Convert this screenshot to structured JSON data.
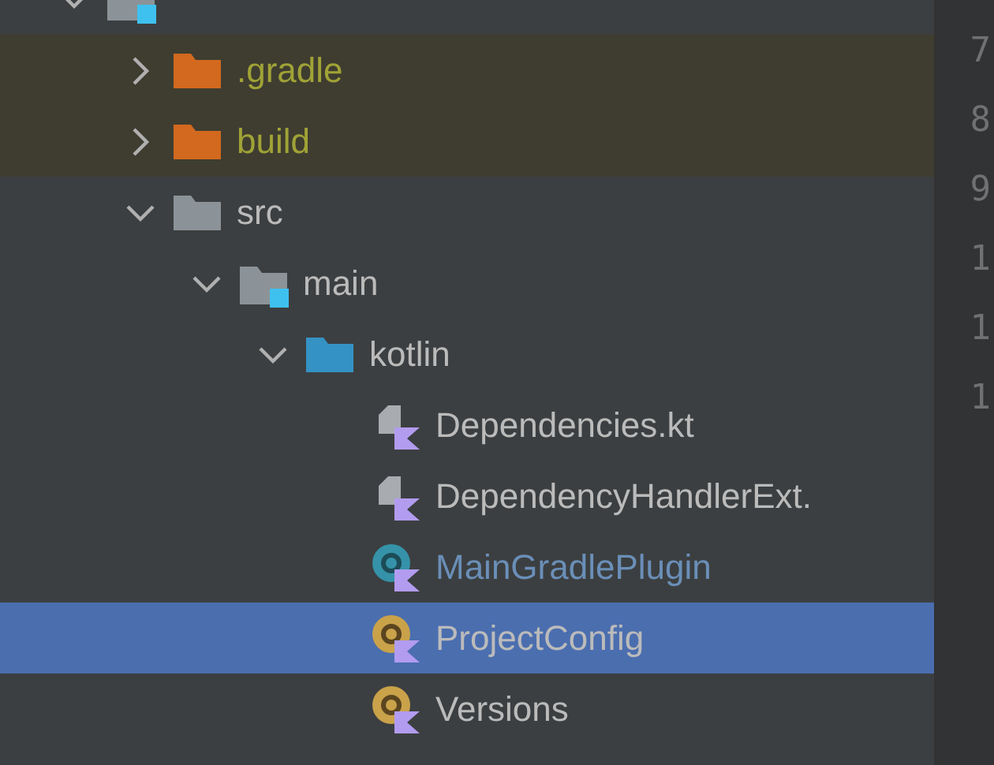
{
  "tree": [
    {
      "kind": "module",
      "expanded": true,
      "selected": false,
      "children": [
        {
          "label": ".gradle",
          "kind": "folder",
          "excluded": true,
          "modified": false,
          "expanded": false,
          "selected": false
        },
        {
          "label": "build",
          "kind": "folder",
          "excluded": true,
          "modified": false,
          "expanded": false,
          "selected": false
        },
        {
          "label": "src",
          "kind": "folder",
          "excluded": false,
          "modified": false,
          "expanded": true,
          "selected": false,
          "children": [
            {
              "label": "main",
              "kind": "module",
              "excluded": false,
              "modified": false,
              "expanded": true,
              "selected": false,
              "children": [
                {
                  "label": "kotlin",
                  "kind": "source-folder",
                  "excluded": false,
                  "modified": false,
                  "expanded": true,
                  "selected": false,
                  "children": [
                    {
                      "label": "Dependencies.kt",
                      "kind": "kotlin-file",
                      "excluded": false,
                      "modified": false,
                      "selected": false
                    },
                    {
                      "label": "DependencyHandlerExt.",
                      "kind": "kotlin-file",
                      "excluded": false,
                      "modified": false,
                      "selected": false
                    },
                    {
                      "label": "MainGradlePlugin",
                      "kind": "kotlin-class",
                      "excluded": false,
                      "modified": true,
                      "selected": false
                    },
                    {
                      "label": "ProjectConfig",
                      "kind": "kotlin-object",
                      "excluded": false,
                      "modified": false,
                      "selected": true
                    },
                    {
                      "label": "Versions",
                      "kind": "kotlin-object",
                      "excluded": false,
                      "modified": false,
                      "selected": false
                    }
                  ]
                }
              ]
            }
          ]
        }
      ]
    }
  ],
  "line_numbers": [
    "7",
    "8",
    "9",
    "1",
    "1",
    "1"
  ]
}
